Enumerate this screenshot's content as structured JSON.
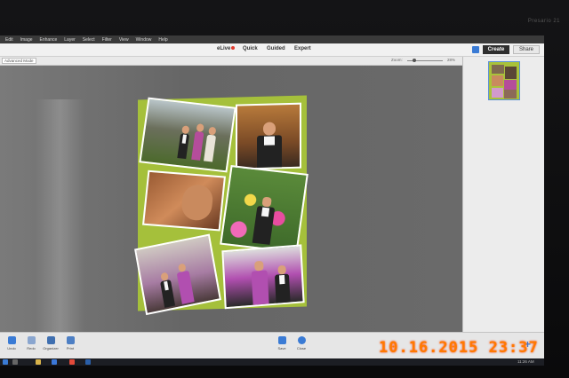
{
  "menu": [
    "Edit",
    "Image",
    "Enhance",
    "Layer",
    "Select",
    "Filter",
    "View",
    "Window",
    "Help"
  ],
  "modes": {
    "elive": "eLive",
    "quick": "Quick",
    "guided": "Guided",
    "expert": "Expert"
  },
  "buttons": {
    "create": "Create",
    "share": "Share"
  },
  "options": {
    "advanced_mode": "Advanced Mode",
    "zoom_label": "Zoom:",
    "zoom_value": "28%",
    "zoom_level": 0.28
  },
  "bottombar": [
    {
      "label": "Undo",
      "icon": "undo-icon"
    },
    {
      "label": "Redo",
      "icon": "redo-icon"
    },
    {
      "label": "Organizer",
      "icon": "organizer-icon"
    },
    {
      "label": "Print",
      "icon": "print-icon"
    },
    {
      "label": "Save",
      "icon": "save-icon"
    },
    {
      "label": "Close",
      "icon": "close-icon"
    }
  ],
  "taskbar": {
    "clock": "11:26 AM"
  },
  "monitor_brand": "Presario 21",
  "datestamp": "10.16.2015 23:37",
  "colors": {
    "create_bg": "#2e2e2e",
    "accent": "#3a7bd5",
    "collage_bg": "#a5c03b",
    "datestamp": "#ff7a00"
  }
}
